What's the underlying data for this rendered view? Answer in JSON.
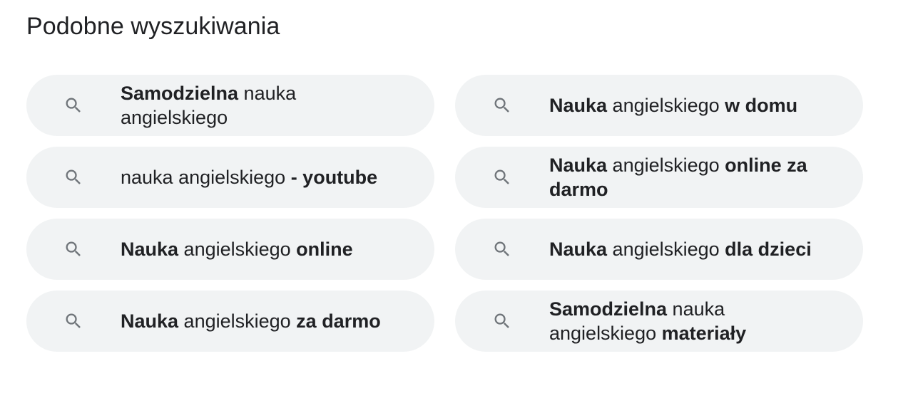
{
  "section": {
    "title": "Podobne wyszukiwania"
  },
  "icon": "search-icon",
  "colors": {
    "chip_background": "#f1f3f4",
    "text": "#202124",
    "icon": "#70757a"
  },
  "related_searches": [
    {
      "lines": [
        [
          {
            "text": "Samodzielna",
            "bold": true
          },
          {
            "text": " nauka",
            "bold": false
          }
        ],
        [
          {
            "text": "angielskiego",
            "bold": false
          }
        ]
      ]
    },
    {
      "lines": [
        [
          {
            "text": "Nauka",
            "bold": true
          },
          {
            "text": " angielskiego ",
            "bold": false
          },
          {
            "text": "w domu",
            "bold": true
          }
        ]
      ]
    },
    {
      "lines": [
        [
          {
            "text": "nauka angielskiego ",
            "bold": false
          },
          {
            "text": "- youtube",
            "bold": true
          }
        ]
      ]
    },
    {
      "lines": [
        [
          {
            "text": "Nauka",
            "bold": true
          },
          {
            "text": " angielskiego ",
            "bold": false
          },
          {
            "text": "online za",
            "bold": true
          }
        ],
        [
          {
            "text": "darmo",
            "bold": true
          }
        ]
      ]
    },
    {
      "lines": [
        [
          {
            "text": "Nauka",
            "bold": true
          },
          {
            "text": " angielskiego ",
            "bold": false
          },
          {
            "text": "online",
            "bold": true
          }
        ]
      ]
    },
    {
      "lines": [
        [
          {
            "text": "Nauka",
            "bold": true
          },
          {
            "text": " angielskiego ",
            "bold": false
          },
          {
            "text": "dla dzieci",
            "bold": true
          }
        ]
      ]
    },
    {
      "lines": [
        [
          {
            "text": "Nauka",
            "bold": true
          },
          {
            "text": " angielskiego ",
            "bold": false
          },
          {
            "text": "za darmo",
            "bold": true
          }
        ]
      ]
    },
    {
      "lines": [
        [
          {
            "text": "Samodzielna",
            "bold": true
          },
          {
            "text": " nauka",
            "bold": false
          }
        ],
        [
          {
            "text": "angielskiego ",
            "bold": false
          },
          {
            "text": "materiały",
            "bold": true
          }
        ]
      ]
    }
  ]
}
